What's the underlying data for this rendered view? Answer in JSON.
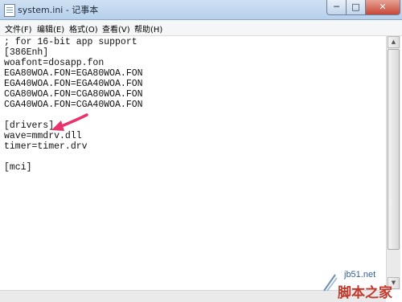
{
  "window": {
    "title": "system.ini - 记事本"
  },
  "controls": {
    "minimize": "─",
    "maximize": "□",
    "close": "✕"
  },
  "menu": [
    {
      "label": "文件(F)"
    },
    {
      "label": "编辑(E)"
    },
    {
      "label": "格式(O)"
    },
    {
      "label": "查看(V)"
    },
    {
      "label": "帮助(H)"
    }
  ],
  "content": {
    "lines": [
      "; for 16-bit app support",
      "[386Enh]",
      "woafont=dosapp.fon",
      "EGA80WOA.FON=EGA80WOA.FON",
      "EGA40WOA.FON=EGA40WOA.FON",
      "CGA80WOA.FON=CGA80WOA.FON",
      "CGA40WOA.FON=CGA40WOA.FON",
      "",
      "[drivers]",
      "wave=mmdrv.dll",
      "timer=timer.drv",
      "",
      "[mci]"
    ]
  },
  "annotation": {
    "color": "#e8336d"
  },
  "watermark": {
    "url": "jb51.net",
    "name": "脚本之家",
    "color": "#c0392b"
  }
}
